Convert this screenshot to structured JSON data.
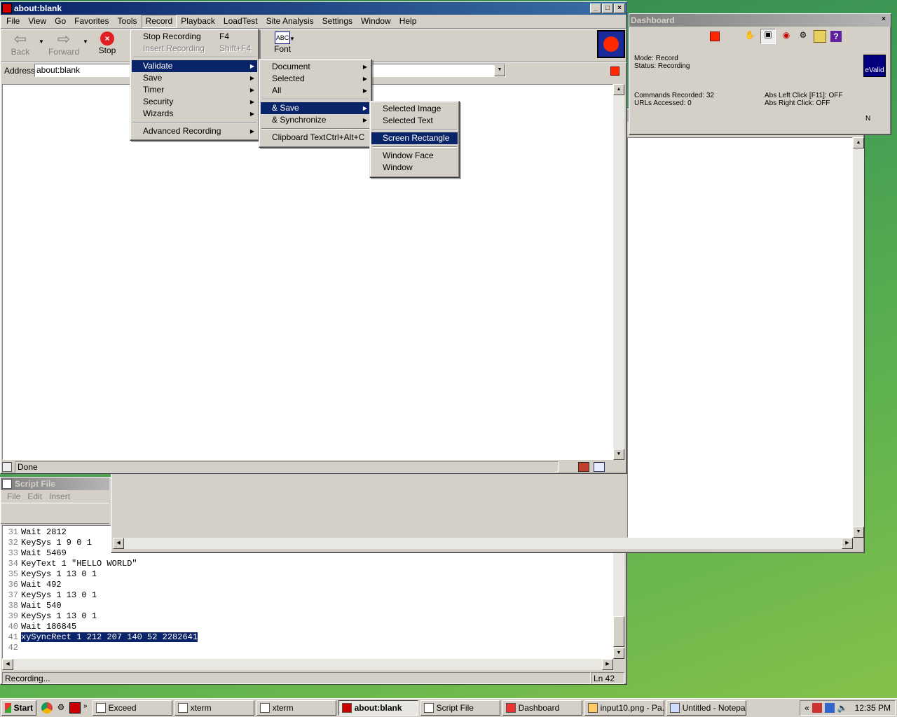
{
  "main_window": {
    "title": "about:blank",
    "menus": [
      "File",
      "View",
      "Go",
      "Favorites",
      "Tools",
      "Record",
      "Playback",
      "LoadTest",
      "Site Analysis",
      "Settings",
      "Window",
      "Help"
    ],
    "toolbar": {
      "back": "Back",
      "forward": "Forward",
      "stop": "Stop",
      "font": "Font"
    },
    "address_label": "Address",
    "address_value": "about:blank",
    "status_text": "Done"
  },
  "record_menu": {
    "items": [
      {
        "label": "Stop Recording",
        "shortcut": "F4"
      },
      {
        "label": "Insert Recording",
        "shortcut": "Shift+F4"
      },
      {
        "label": "Validate"
      },
      {
        "label": "Save"
      },
      {
        "label": "Timer"
      },
      {
        "label": "Security"
      },
      {
        "label": "Wizards"
      },
      {
        "label": "Advanced Recording"
      }
    ]
  },
  "validate_menu": {
    "items": [
      {
        "label": "Document"
      },
      {
        "label": "Selected"
      },
      {
        "label": "All"
      },
      {
        "label": "& Save"
      },
      {
        "label": "& Synchronize"
      },
      {
        "label": "Clipboard Text",
        "shortcut": "Ctrl+Alt+C"
      }
    ]
  },
  "save_menu": {
    "items": [
      {
        "label": "Selected Image"
      },
      {
        "label": "Selected Text"
      },
      {
        "label": "Screen Rectangle"
      },
      {
        "label": "Window Face"
      },
      {
        "label": "Window"
      }
    ]
  },
  "dashboard": {
    "title": "Dashboard",
    "mode": "Mode: Record",
    "status": "Status: Recording",
    "commands": "Commands Recorded: 32",
    "urls": "URLs Accessed: 0",
    "abs_left": "Abs Left Click [F11]: OFF",
    "abs_right": "Abs Right Click: OFF",
    "logo": "eValid",
    "edge_letter": "N"
  },
  "script_window": {
    "title": "Script File",
    "menus": [
      "File",
      "Edit",
      "Insert"
    ],
    "lines": [
      {
        "n": "31",
        "text": "Wait 2812"
      },
      {
        "n": "32",
        "text": "KeySys 1 9 0 1"
      },
      {
        "n": "33",
        "text": "Wait 5469"
      },
      {
        "n": "34",
        "text": "KeyText 1 \"HELLO WORLD\""
      },
      {
        "n": "35",
        "text": "KeySys 1 13 0 1"
      },
      {
        "n": "36",
        "text": "Wait 492"
      },
      {
        "n": "37",
        "text": "KeySys 1 13 0 1"
      },
      {
        "n": "38",
        "text": "Wait 540"
      },
      {
        "n": "39",
        "text": "KeySys 1 13 0 1"
      },
      {
        "n": "40",
        "text": "Wait 186845"
      },
      {
        "n": "41",
        "text": "xySyncRect 1 212 207 140 52 2282641"
      },
      {
        "n": "42",
        "text": ""
      }
    ],
    "status_left": "Recording...",
    "status_right": "Ln 42"
  },
  "taskbar": {
    "start": "Start",
    "tasks": [
      "Exceed",
      "xterm",
      "xterm",
      "about:blank",
      "Script File",
      "Dashboard",
      "input10.png - Pa...",
      "Untitled - Notepad"
    ],
    "clock": "12:35 PM"
  },
  "colors": {
    "menu_highlight": "#0a246a",
    "record_red": "#ff2a00"
  }
}
